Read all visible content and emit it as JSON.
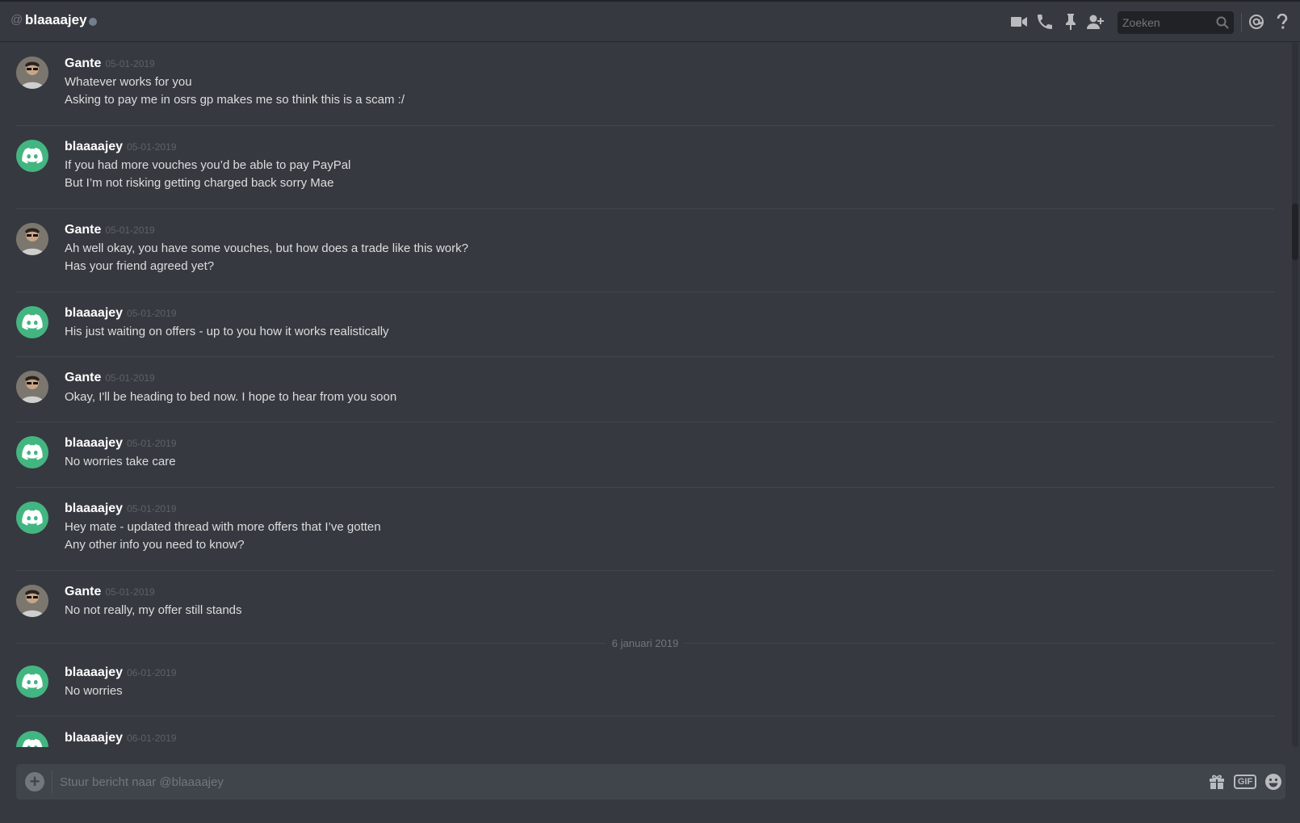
{
  "header": {
    "at_symbol": "@",
    "channel_name": "blaaaajey",
    "search_placeholder": "Zoeken"
  },
  "icons": {
    "video": "video-camera-icon",
    "call": "phone-icon",
    "pin": "pin-icon",
    "add_friend": "add-friend-icon",
    "mention": "at-icon",
    "help": "help-icon",
    "search": "search-icon"
  },
  "colors": {
    "background": "#36393f",
    "discord_avatar": "#43b581",
    "username": "#ffffff",
    "text": "#dcddde",
    "muted": "#72767d"
  },
  "messages": [
    {
      "author": "Gante",
      "timestamp": "05-01-2019",
      "avatar": "photo",
      "lines": [
        "Whatever works for you",
        "Asking to pay me in osrs gp makes me so think this is a scam :/"
      ]
    },
    {
      "author": "blaaaajey",
      "timestamp": "05-01-2019",
      "avatar": "discord",
      "lines": [
        "If you had more vouches you’d be able to pay PayPal",
        "But I’m not risking getting charged back sorry Mae"
      ]
    },
    {
      "author": "Gante",
      "timestamp": "05-01-2019",
      "avatar": "photo",
      "lines": [
        "Ah well okay, you have some vouches, but how does a trade like this work?",
        "Has your friend agreed yet?"
      ]
    },
    {
      "author": "blaaaajey",
      "timestamp": "05-01-2019",
      "avatar": "discord",
      "lines": [
        "His just waiting on offers - up to you how it works realistically"
      ]
    },
    {
      "author": "Gante",
      "timestamp": "05-01-2019",
      "avatar": "photo",
      "lines": [
        "Okay, I'll be heading to bed now. I hope to hear from you soon"
      ]
    },
    {
      "author": "blaaaajey",
      "timestamp": "05-01-2019",
      "avatar": "discord",
      "lines": [
        "No worries take care"
      ]
    },
    {
      "author": "blaaaajey",
      "timestamp": "05-01-2019",
      "avatar": "discord",
      "lines": [
        "Hey mate - updated thread with more offers that I’ve gotten",
        "Any other info you need to know?"
      ]
    },
    {
      "author": "Gante",
      "timestamp": "05-01-2019",
      "avatar": "photo",
      "lines": [
        "No not really, my offer still stands"
      ]
    },
    {
      "author": "blaaaajey",
      "timestamp": "06-01-2019",
      "avatar": "discord",
      "lines": [
        "No worries"
      ]
    },
    {
      "author": "blaaaajey",
      "timestamp": "06-01-2019",
      "avatar": "discord",
      "lines": []
    }
  ],
  "date_separator": "6 januari 2019",
  "composer": {
    "placeholder": "Stuur bericht naar @blaaaajey",
    "gif_label": "GIF"
  }
}
